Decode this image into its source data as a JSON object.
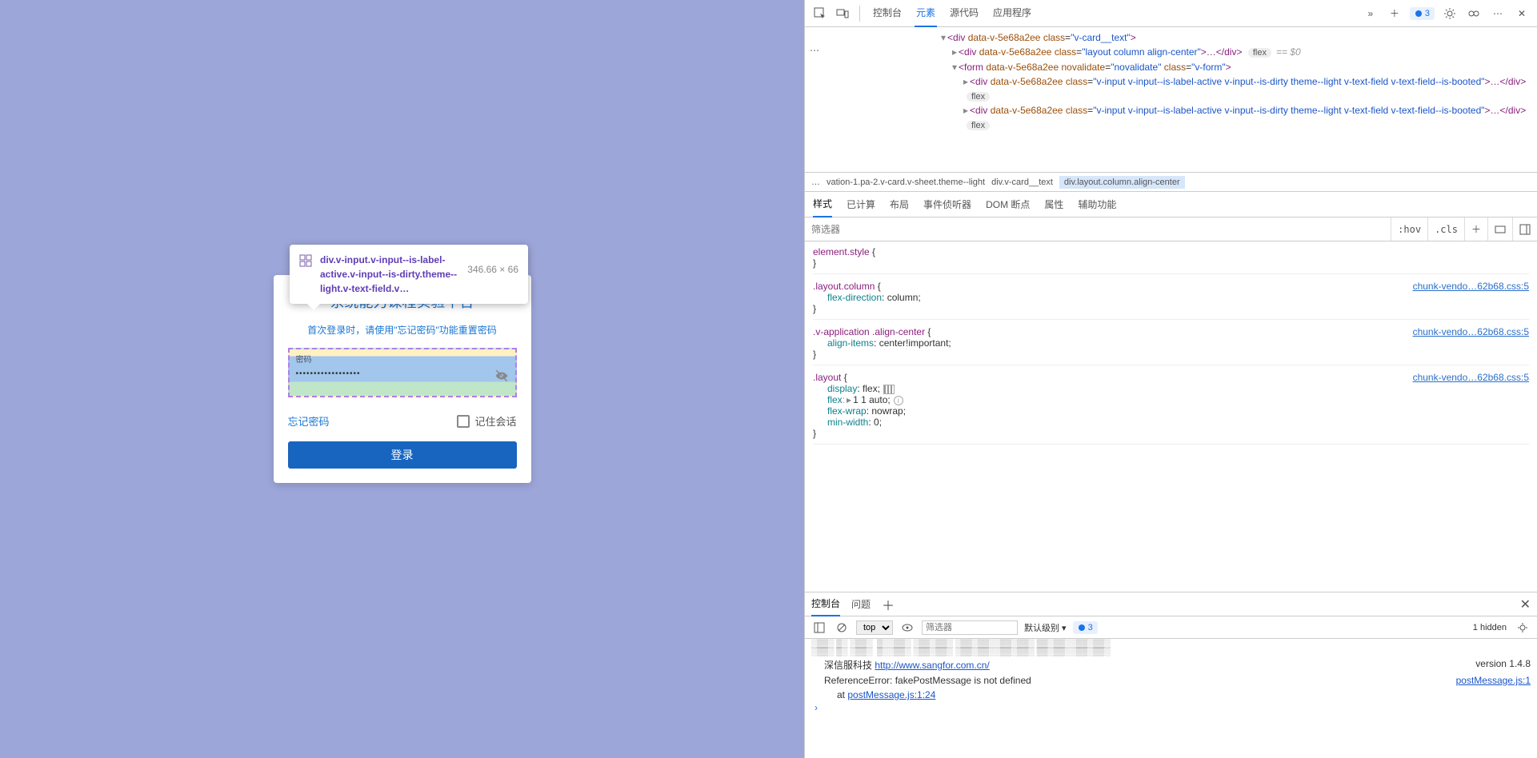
{
  "login": {
    "title": "系统能力课程实验平台",
    "subtitle": "首次登录时，请使用\"忘记密码\"功能重置密码",
    "password_label": "密码",
    "password_value": "••••••••••••••••••",
    "forgot": "忘记密码",
    "remember": "记住会话",
    "submit": "登录"
  },
  "picker": {
    "classes": "div.v-input.v-input--is-label-active.v-input--is-dirty.theme--light.v-text-field.v…",
    "size": "346.66 × 66"
  },
  "devtools": {
    "tabs": [
      "控制台",
      "元素",
      "源代码",
      "应用程序"
    ],
    "active_tab": "元素",
    "issue_count": "3",
    "breadcrumb": [
      "…",
      "vation-1.pa-2.v-card.v-sheet.theme--light",
      "div.v-card__text",
      "div.layout.column.align-center"
    ],
    "styles_tabs": [
      "样式",
      "已计算",
      "布局",
      "事件侦听器",
      "DOM 断点",
      "属性",
      "辅助功能"
    ],
    "filter_placeholder": "筛选器",
    "filter_btns": [
      ":hov",
      ".cls",
      "＋"
    ],
    "elements_tree": {
      "line1": "<div data-v-5e68a2ee class=\"v-card__text\">",
      "line2": "<div data-v-5e68a2ee class=\"layout column align-center\">…</div>",
      "line2_badge": "flex",
      "line2_eq": "== $0",
      "line3": "<form data-v-5e68a2ee novalidate=\"novalidate\" class=\"v-form\">",
      "line4": "<div data-v-5e68a2ee class=\"v-input v-input--is-label-active v-input--is-dirty theme--light v-text-field v-text-field--is-booted\">…</div>",
      "line4_badge": "flex",
      "line5": "<div data-v-5e68a2ee class=\"v-input v-input--is-label-active v-input--is-dirty theme--light v-text-field v-text-field--is-booted\">…</div>",
      "line5_badge": "flex"
    },
    "rules": [
      {
        "sel": "element.style",
        "src": "",
        "props": []
      },
      {
        "sel": ".layout.column",
        "src": "chunk-vendo…62b68.css:5",
        "props": [
          {
            "n": "flex-direction",
            "v": "column;"
          }
        ]
      },
      {
        "sel": ".v-application .align-center",
        "src": "chunk-vendo…62b68.css:5",
        "props": [
          {
            "n": "align-items",
            "v": "center!important;"
          }
        ]
      },
      {
        "sel": ".layout",
        "src": "chunk-vendo…62b68.css:5",
        "props": [
          {
            "n": "display",
            "v": "flex;",
            "swatch": true
          },
          {
            "n": "flex",
            "v": "1 1 auto;",
            "inherited": true,
            "tri": true,
            "info": true
          },
          {
            "n": "flex-wrap",
            "v": "nowrap;"
          },
          {
            "n": "min-width",
            "v": "0;"
          }
        ]
      }
    ],
    "drawer_tabs": [
      "控制台",
      "问题"
    ],
    "console_top": "top",
    "console_filter_ph": "筛选器",
    "console_level": "默认级别",
    "console_hidden": "1 hidden",
    "console_msgs": [
      {
        "indent": 1,
        "text": "深信服科技  ",
        "link": "http://www.sangfor.com.cn/",
        "right": "version 1.4.8"
      },
      {
        "indent": 1,
        "text": "ReferenceError: fakePostMessage is not defined",
        "right_link": "postMessage.js:1"
      },
      {
        "indent": 2,
        "text": "at ",
        "link": "postMessage.js:1:24"
      }
    ]
  }
}
